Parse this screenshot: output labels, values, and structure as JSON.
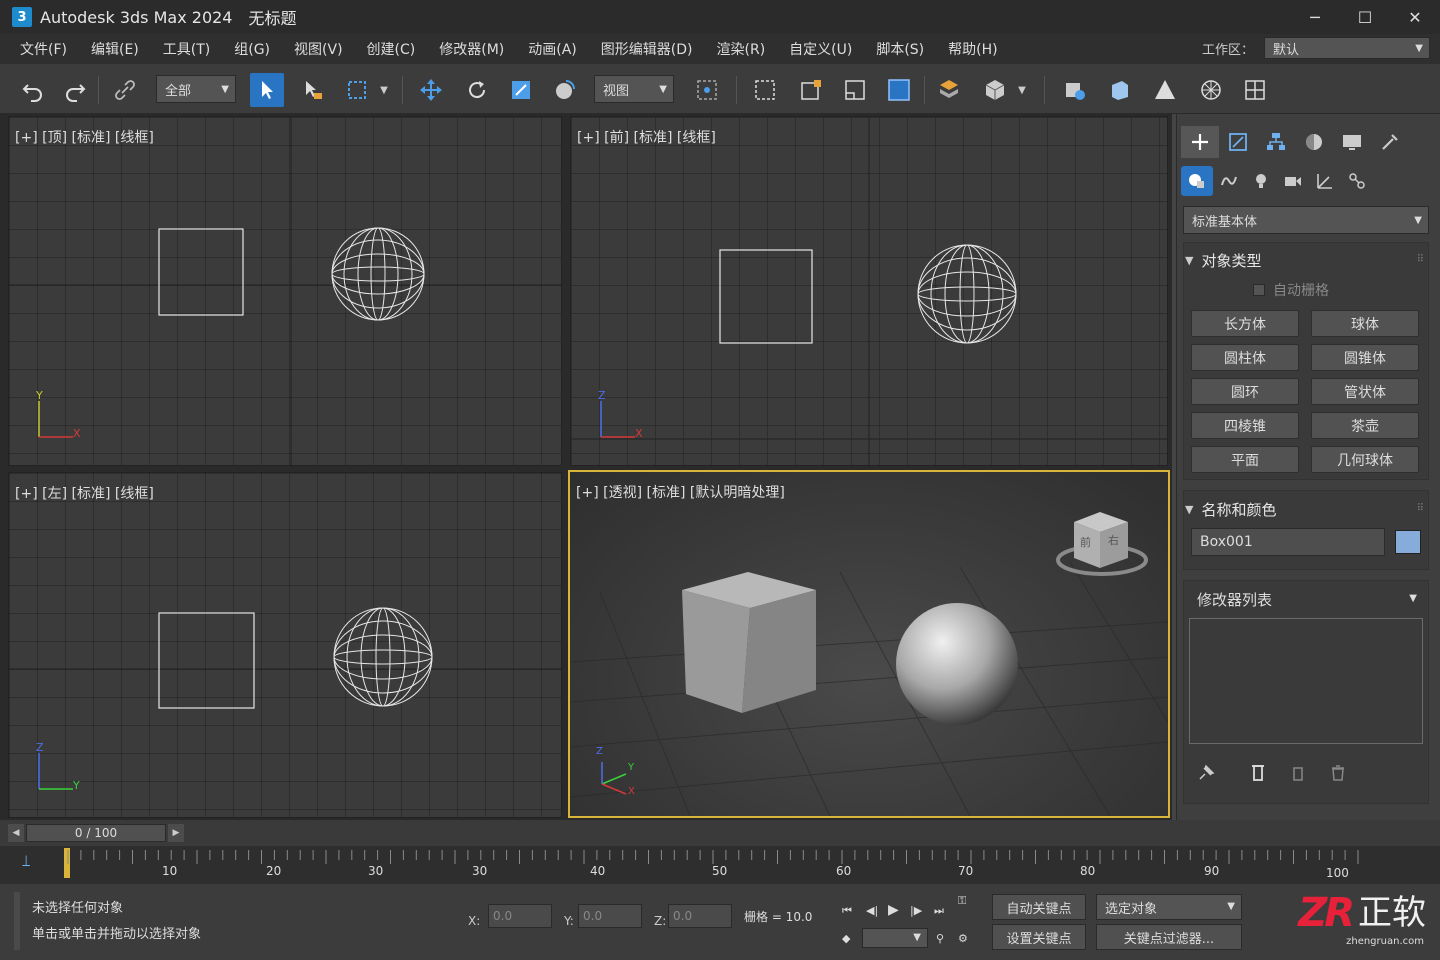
{
  "titlebar": {
    "app_icon": "3",
    "app_name": "Autodesk 3ds Max 2024",
    "document": "无标题",
    "minimize": "─",
    "maximize": "☐",
    "close": "✕"
  },
  "menu": {
    "items": [
      "文件(F)",
      "编辑(E)",
      "工具(T)",
      "组(G)",
      "视图(V)",
      "创建(C)",
      "修改器(M)",
      "动画(A)",
      "图形编辑器(D)",
      "渲染(R)",
      "自定义(U)",
      "脚本(S)",
      "帮助(H)"
    ],
    "workspace_label": "工作区：",
    "workspace_value": "默认"
  },
  "toolbar": {
    "selection_filter": "全部",
    "reference_coord": "视图",
    "icons": [
      "undo-icon",
      "redo-icon",
      "link-icon",
      "select-icon",
      "select-by-name-icon",
      "rect-selection-icon",
      "move-icon",
      "rotate-icon",
      "scale-icon",
      "place-icon",
      "pivot-icon",
      "snap-icon",
      "window-crossing-icon",
      "mirror-icon",
      "align-icon",
      "layer-icon",
      "render-setup-icon",
      "render-frame-icon",
      "render-icon",
      "material-editor-icon",
      "schematic-icon",
      "curve-editor-icon",
      "teapot-render-icon",
      "viewport-layout-icon"
    ]
  },
  "viewports": {
    "top": {
      "label": "[+] [顶] [标准] [线框]",
      "axis_v": "Y",
      "axis_h": "X"
    },
    "front": {
      "label": "[+] [前] [标准] [线框]",
      "axis_v": "Z",
      "axis_h": "X"
    },
    "left": {
      "label": "[+] [左] [标准] [线框]",
      "axis_v": "Z",
      "axis_h": "Y"
    },
    "persp": {
      "label": "[+] [透视] [标准] [默认明暗处理]",
      "axis_z": "Z",
      "axis_y": "Y",
      "axis_x": "X",
      "viewcube_front": "前",
      "viewcube_right": "右"
    }
  },
  "command_panel": {
    "category": "标准基本体",
    "object_type": {
      "title": "对象类型",
      "autogrid": "自动栅格",
      "buttons": [
        "长方体",
        "球体",
        "圆柱体",
        "圆锥体",
        "圆环",
        "管状体",
        "四棱锥",
        "茶壶",
        "平面",
        "几何球体"
      ]
    },
    "name_color": {
      "title": "名称和颜色",
      "name": "Box001",
      "color": "#86acd9"
    },
    "modifier_list": "修改器列表"
  },
  "timeline": {
    "frame": "0 / 100",
    "ticks": [
      "10",
      "20",
      "30",
      "30",
      "40",
      "50",
      "60",
      "70",
      "80",
      "90",
      "100"
    ]
  },
  "status": {
    "line1": "未选择任何对象",
    "line2": "单击或单击并拖动以选择对象",
    "x_label": "X:",
    "x_value": "0.0",
    "y_label": "Y:",
    "y_value": "0.0",
    "z_label": "Z:",
    "z_value": "0.0",
    "grid": "栅格 = 10.0",
    "auto_key": "自动关键点",
    "set_key": "设置关键点",
    "selected": "选定对象",
    "key_filters": "关键点过滤器..."
  },
  "logo": {
    "mark": "ZR",
    "text": "正软",
    "url": "zhengruan.com"
  }
}
